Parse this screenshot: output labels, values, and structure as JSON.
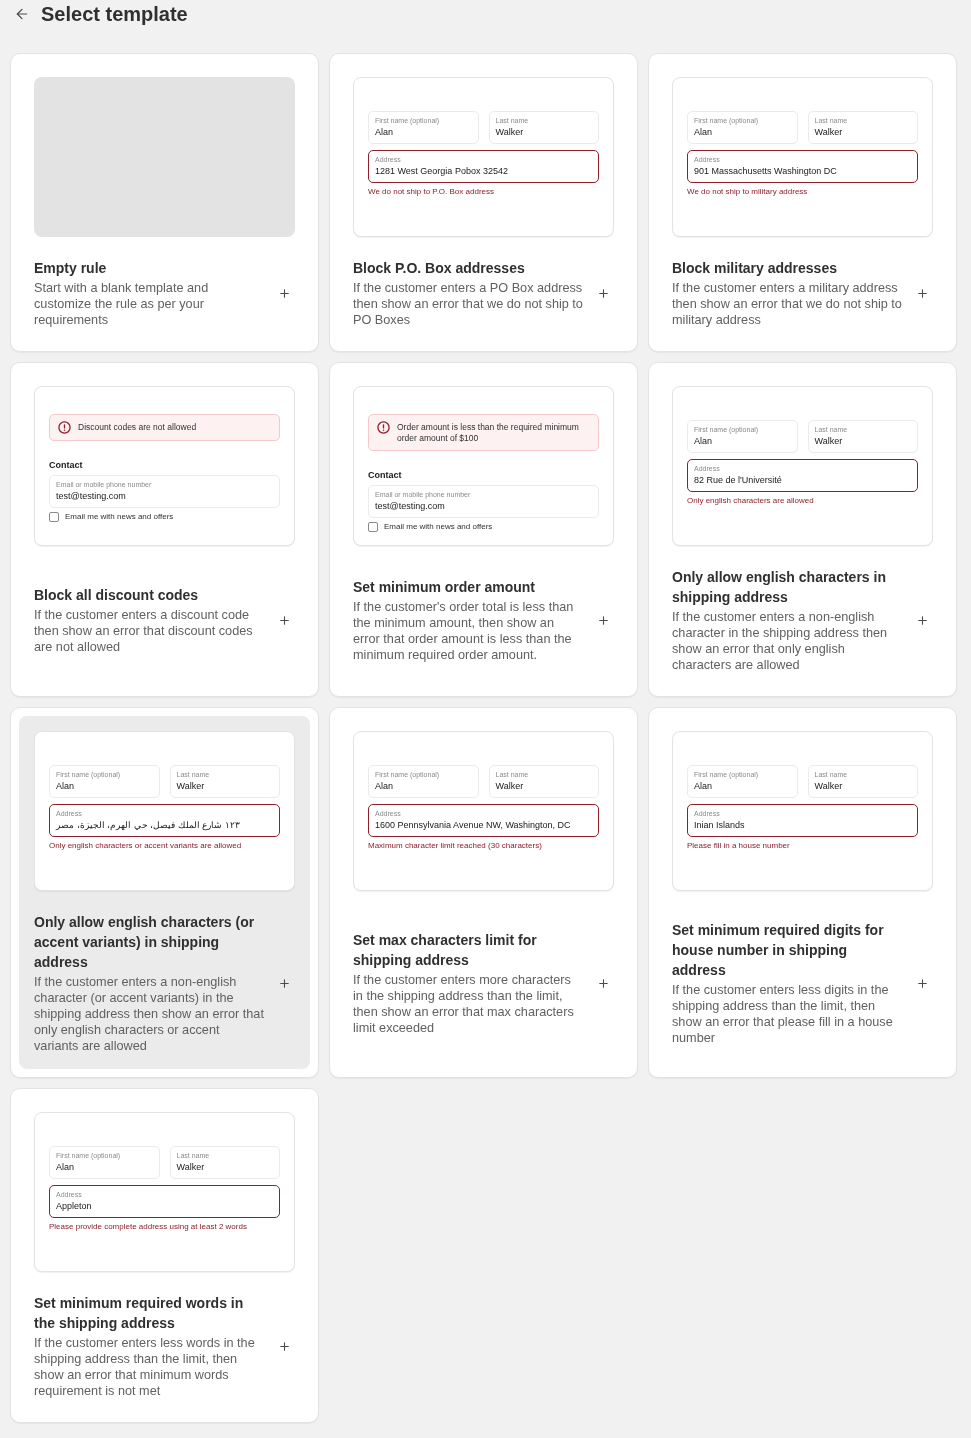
{
  "header": {
    "title": "Select template"
  },
  "templates": [
    {
      "title": "Empty rule",
      "description": "Start with a blank template and customize the rule as per your requirements",
      "selected": false,
      "preview": {
        "kind": "empty"
      }
    },
    {
      "title": "Block P.O. Box addresses",
      "description": "If the customer enters a PO Box address then show an error that we do not ship to PO Boxes",
      "selected": false,
      "preview": {
        "kind": "address",
        "first_name": {
          "label": "First name (optional)",
          "value": "Alan"
        },
        "last_name": {
          "label": "Last name",
          "value": "Walker"
        },
        "address": {
          "label": "Address",
          "value": "1281 West Georgia Pobox 32542"
        },
        "error": "We do not ship to P.O. Box address"
      }
    },
    {
      "title": "Block military addresses",
      "description": "If the customer enters a military address then show an error that we do not ship to military address",
      "selected": false,
      "preview": {
        "kind": "address",
        "first_name": {
          "label": "First name (optional)",
          "value": "Alan"
        },
        "last_name": {
          "label": "Last name",
          "value": "Walker"
        },
        "address": {
          "label": "Address",
          "value": "901 Massachusetts Washington DC"
        },
        "error": "We do not ship to military address"
      }
    },
    {
      "title": "Block all discount codes",
      "description": "If the customer enters a discount code then show an error that discount codes are not allowed",
      "selected": false,
      "preview": {
        "kind": "checkout",
        "alert": "Discount codes are not allowed",
        "section": "Contact",
        "email": {
          "label": "Email or mobile phone number",
          "value": "test@testing.com"
        },
        "newsletter": {
          "label": "Email me with news and offers",
          "checked": false
        }
      }
    },
    {
      "title": "Set minimum order amount",
      "description": "If the customer's order total is less than the minimum amount, then show an error that order amount is less than the minimum required order amount.",
      "selected": false,
      "preview": {
        "kind": "checkout",
        "alert": "Order amount is less than the required minimum order amount of $100",
        "section": "Contact",
        "email": {
          "label": "Email or mobile phone number",
          "value": "test@testing.com"
        },
        "newsletter": {
          "label": "Email me with news and offers",
          "checked": false
        }
      }
    },
    {
      "title": "Only allow english characters in shipping address",
      "description": "If the customer enters a non-english character in the shipping address then show an error that only english characters are allowed",
      "selected": false,
      "preview": {
        "kind": "address",
        "first_name": {
          "label": "First name (optional)",
          "value": "Alan"
        },
        "last_name": {
          "label": "Last name",
          "value": "Walker"
        },
        "address": {
          "label": "Address",
          "value": "82 Rue de l'Université"
        },
        "error": "Only english characters are allowed"
      }
    },
    {
      "title": "Only allow english characters (or accent variants) in shipping address",
      "description": "If the customer enters a non-english character (or accent variants) in the shipping address then show an error that only english characters or accent variants are allowed",
      "selected": true,
      "preview": {
        "kind": "address",
        "first_name": {
          "label": "First name (optional)",
          "value": "Alan"
        },
        "last_name": {
          "label": "Last name",
          "value": "Walker"
        },
        "address": {
          "label": "Address",
          "value": "١٢٣ شارع الملك فيصل، حي الهرم، الجيزة، مصر"
        },
        "error": "Only english characters or accent variants are allowed"
      }
    },
    {
      "title": "Set max characters limit for shipping address",
      "description": "If the customer enters more characters in the shipping address than the limit, then show an error that max characters limit exceeded",
      "selected": false,
      "preview": {
        "kind": "address",
        "first_name": {
          "label": "First name (optional)",
          "value": "Alan"
        },
        "last_name": {
          "label": "Last name",
          "value": "Walker"
        },
        "address": {
          "label": "Address",
          "value": "1600 Pennsylvania Avenue NW, Washington, DC"
        },
        "error": "Maximum character limit reached (30 characters)"
      }
    },
    {
      "title": "Set minimum required digits for house number in shipping address",
      "description": "If the customer enters less digits in the shipping address than the limit, then show an error that please fill in a house number",
      "selected": false,
      "preview": {
        "kind": "address",
        "first_name": {
          "label": "First name (optional)",
          "value": "Alan"
        },
        "last_name": {
          "label": "Last name",
          "value": "Walker"
        },
        "address": {
          "label": "Address",
          "value": "Inian Islands"
        },
        "error": "Please fill in a house number"
      }
    },
    {
      "title": "Set minimum required words in the shipping address",
      "description": "If the customer enters less words in the shipping address than the limit, then show an error that minimum words requirement is not met",
      "selected": false,
      "preview": {
        "kind": "address",
        "first_name": {
          "label": "First name (optional)",
          "value": "Alan"
        },
        "last_name": {
          "label": "Last name",
          "value": "Walker"
        },
        "address": {
          "label": "Address",
          "value": "Appleton"
        },
        "error": "Please provide complete address using at least 2 words"
      }
    }
  ]
}
